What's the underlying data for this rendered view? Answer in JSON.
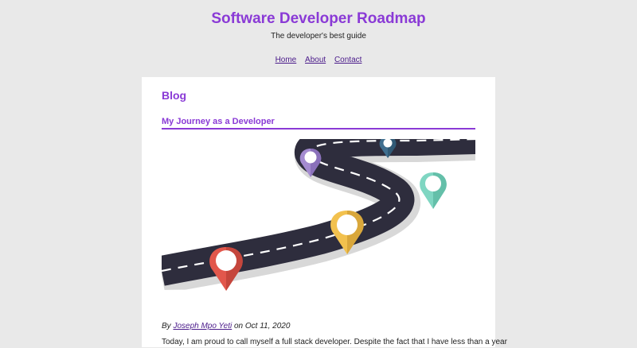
{
  "header": {
    "title": "Software Developer Roadmap",
    "tagline": "The developer's best guide"
  },
  "nav": {
    "items": [
      {
        "label": "Home"
      },
      {
        "label": "About"
      },
      {
        "label": "Contact"
      }
    ]
  },
  "main": {
    "section_heading": "Blog",
    "post": {
      "title": "My Journey as a Developer",
      "image_icon": "winding-road-with-map-pins",
      "byline_prefix": "By",
      "author": "Joseph Mpo Yeti",
      "date_prefix": "on",
      "date": "Oct 11, 2020",
      "excerpt": "Today, I am proud to call myself a full stack developer. Despite the fact that I have less than a year"
    }
  },
  "colors": {
    "page_background": "#e9e9e9",
    "accent": "#8a3ad6",
    "link": "#4a1a8a",
    "card_background": "#ffffff",
    "road": "#2e2d3d",
    "pin_red": "#e2574c",
    "pin_yellow": "#f2c14e",
    "pin_teal": "#7fd6c2",
    "pin_purple": "#a48bd0",
    "pin_blue": "#3f6e8f"
  }
}
